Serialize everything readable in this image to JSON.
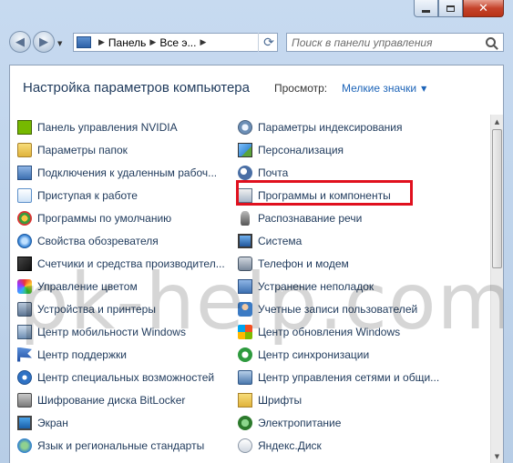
{
  "address_bar": {
    "segments": [
      "Панель",
      "Все э..."
    ]
  },
  "search": {
    "placeholder": "Поиск в панели управления"
  },
  "header": {
    "title": "Настройка параметров компьютера",
    "view_label": "Просмотр:",
    "view_value": "Мелкие значки"
  },
  "items_left": [
    {
      "label": "Панель управления NVIDIA",
      "icon": "nvidia-icon"
    },
    {
      "label": "Параметры папок",
      "icon": "folder-options-icon"
    },
    {
      "label": "Подключения к удаленным рабоч...",
      "icon": "remote-desktop-icon"
    },
    {
      "label": "Приступая к работе",
      "icon": "getting-started-icon"
    },
    {
      "label": "Программы по умолчанию",
      "icon": "default-programs-icon"
    },
    {
      "label": "Свойства обозревателя",
      "icon": "internet-options-icon"
    },
    {
      "label": "Счетчики и средства производител...",
      "icon": "performance-icon"
    },
    {
      "label": "Управление цветом",
      "icon": "color-management-icon"
    },
    {
      "label": "Устройства и принтеры",
      "icon": "devices-printers-icon"
    },
    {
      "label": "Центр мобильности Windows",
      "icon": "mobility-center-icon"
    },
    {
      "label": "Центр поддержки",
      "icon": "action-center-flag-icon"
    },
    {
      "label": "Центр специальных возможностей",
      "icon": "ease-of-access-icon"
    },
    {
      "label": "Шифрование диска BitLocker",
      "icon": "bitlocker-icon"
    },
    {
      "label": "Экран",
      "icon": "display-icon"
    },
    {
      "label": "Язык и региональные стандарты",
      "icon": "region-language-icon"
    }
  ],
  "items_right": [
    {
      "label": "Параметры индексирования",
      "icon": "indexing-icon"
    },
    {
      "label": "Персонализация",
      "icon": "personalization-icon"
    },
    {
      "label": "Почта",
      "icon": "mail-icon"
    },
    {
      "label": "Программы и компоненты",
      "icon": "programs-features-icon"
    },
    {
      "label": "Распознавание речи",
      "icon": "speech-recognition-icon"
    },
    {
      "label": "Система",
      "icon": "system-icon"
    },
    {
      "label": "Телефон и модем",
      "icon": "phone-modem-icon"
    },
    {
      "label": "Устранение неполадок",
      "icon": "troubleshooting-icon"
    },
    {
      "label": "Учетные записи пользователей",
      "icon": "user-accounts-icon"
    },
    {
      "label": "Центр обновления Windows",
      "icon": "windows-update-icon"
    },
    {
      "label": "Центр синхронизации",
      "icon": "sync-center-icon"
    },
    {
      "label": "Центр управления сетями и общи...",
      "icon": "network-center-icon"
    },
    {
      "label": "Шрифты",
      "icon": "fonts-icon"
    },
    {
      "label": "Электропитание",
      "icon": "power-options-icon"
    },
    {
      "label": "Яндекс.Диск",
      "icon": "yandex-disk-icon"
    }
  ],
  "watermark": "pk-help.com",
  "colors": {
    "link_text": "#1e395b",
    "view_value": "#1d64b8",
    "highlight": "#e0101e"
  }
}
